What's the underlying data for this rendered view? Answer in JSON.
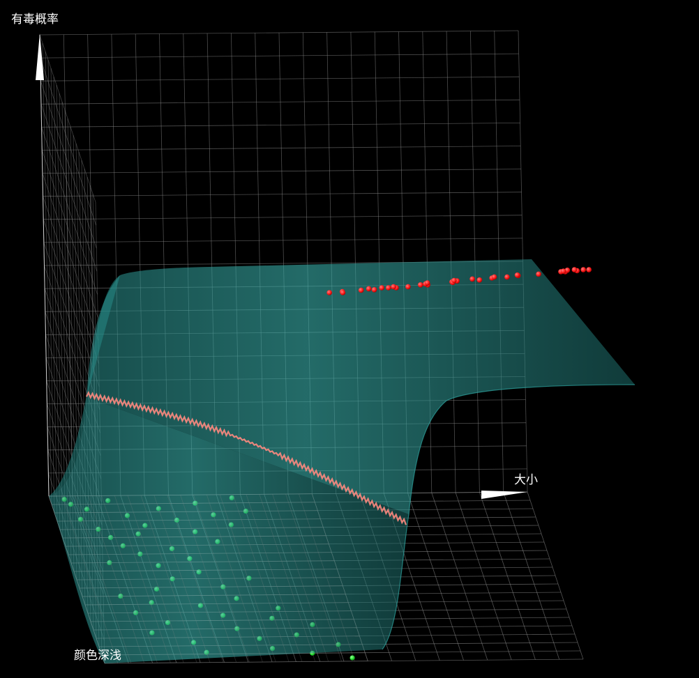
{
  "chart_data": {
    "type": "scatter3d-surface",
    "axes": {
      "x": {
        "label": "颜色深浅",
        "range": [
          0,
          1
        ]
      },
      "y": {
        "label": "大小",
        "range": [
          0,
          1
        ]
      },
      "z": {
        "label": "有毒概率",
        "range": [
          0,
          1
        ]
      }
    },
    "grid": true,
    "colors": {
      "background": "#000000",
      "grid": "#8c8c8c",
      "surface": "#2fa8a4",
      "boundary": "#ff8a80",
      "toxic_points": "#ff1a1a",
      "safe_points": "#22e52e",
      "axis_arrow": "#ffffff"
    },
    "series": [
      {
        "points": [
          [
            0.62,
            0.62,
            1
          ],
          [
            0.55,
            0.72,
            1
          ],
          [
            0.5,
            0.66,
            1
          ],
          [
            0.44,
            0.6,
            1
          ],
          [
            0.38,
            0.55,
            1
          ],
          [
            0.3,
            0.52,
            1
          ],
          [
            0.24,
            0.5,
            1
          ],
          [
            0.48,
            0.5,
            1
          ],
          [
            0.53,
            0.56,
            1
          ],
          [
            0.58,
            0.6,
            1
          ],
          [
            0.63,
            0.66,
            1
          ],
          [
            0.36,
            0.62,
            1
          ],
          [
            0.42,
            0.68,
            1
          ],
          [
            0.47,
            0.74,
            1
          ],
          [
            0.65,
            0.71,
            1
          ],
          [
            0.7,
            0.76,
            1
          ],
          [
            0.28,
            0.7,
            1
          ],
          [
            0.33,
            0.75,
            1
          ],
          [
            0.58,
            0.8,
            1
          ],
          [
            0.62,
            0.85,
            1
          ],
          [
            0.52,
            0.86,
            1
          ],
          [
            0.45,
            0.82,
            1
          ],
          [
            0.4,
            0.78,
            1
          ],
          [
            0.68,
            0.82,
            1
          ],
          [
            0.73,
            0.88,
            1
          ],
          [
            0.78,
            0.93,
            1
          ],
          [
            0.82,
            0.95,
            1
          ],
          [
            0.86,
            0.97,
            1
          ],
          [
            0.76,
            0.97,
            1
          ],
          [
            0.7,
            0.93,
            1
          ],
          [
            0.26,
            0.58,
            1
          ],
          [
            0.32,
            0.6,
            1
          ],
          [
            0.56,
            0.96,
            1
          ],
          [
            0.6,
            0.97,
            1
          ],
          [
            0.66,
            0.94,
            1
          ]
        ]
      },
      {
        "points": [
          [
            0.02,
            0.03,
            0
          ],
          [
            0.05,
            0.04,
            0
          ],
          [
            0.08,
            0.07,
            0
          ],
          [
            0.14,
            0.05,
            0
          ],
          [
            0.2,
            0.08,
            0
          ],
          [
            0.25,
            0.1,
            0
          ],
          [
            0.12,
            0.15,
            0
          ],
          [
            0.18,
            0.18,
            0
          ],
          [
            0.23,
            0.16,
            0
          ],
          [
            0.3,
            0.12,
            0
          ],
          [
            0.35,
            0.15,
            0
          ],
          [
            0.08,
            0.22,
            0
          ],
          [
            0.15,
            0.25,
            0
          ],
          [
            0.22,
            0.28,
            0
          ],
          [
            0.32,
            0.22,
            0
          ],
          [
            0.38,
            0.25,
            0
          ],
          [
            0.05,
            0.3,
            0
          ],
          [
            0.12,
            0.33,
            0
          ],
          [
            0.28,
            0.32,
            0
          ],
          [
            0.42,
            0.18,
            0
          ],
          [
            0.46,
            0.26,
            0
          ],
          [
            0.5,
            0.2,
            0
          ],
          [
            0.02,
            0.38,
            0
          ],
          [
            0.1,
            0.4,
            0
          ],
          [
            0.6,
            0.08,
            0
          ],
          [
            0.64,
            0.14,
            0
          ],
          [
            0.7,
            0.1,
            0
          ],
          [
            0.76,
            0.16,
            0
          ],
          [
            0.82,
            0.12,
            0
          ],
          [
            0.88,
            0.2,
            0
          ],
          [
            0.94,
            0.22,
            0
          ],
          [
            0.66,
            0.24,
            0
          ],
          [
            0.72,
            0.28,
            0
          ],
          [
            0.8,
            0.3,
            0
          ],
          [
            0.86,
            0.34,
            0
          ],
          [
            0.92,
            0.36,
            0
          ],
          [
            0.74,
            0.38,
            0
          ],
          [
            0.84,
            0.42,
            0
          ],
          [
            0.95,
            0.44,
            0
          ],
          [
            0.9,
            0.5,
            0
          ],
          [
            0.98,
            0.52,
            0
          ],
          [
            0.62,
            0.32,
            0
          ],
          [
            0.68,
            0.4,
            0
          ],
          [
            0.78,
            0.46,
            0
          ],
          [
            0.56,
            0.16,
            0
          ],
          [
            0.4,
            0.08,
            0
          ],
          [
            0.03,
            0.12,
            0
          ],
          [
            0.18,
            0.36,
            0
          ],
          [
            0.55,
            0.3,
            0
          ],
          [
            0.5,
            0.36,
            0
          ]
        ]
      }
    ]
  }
}
